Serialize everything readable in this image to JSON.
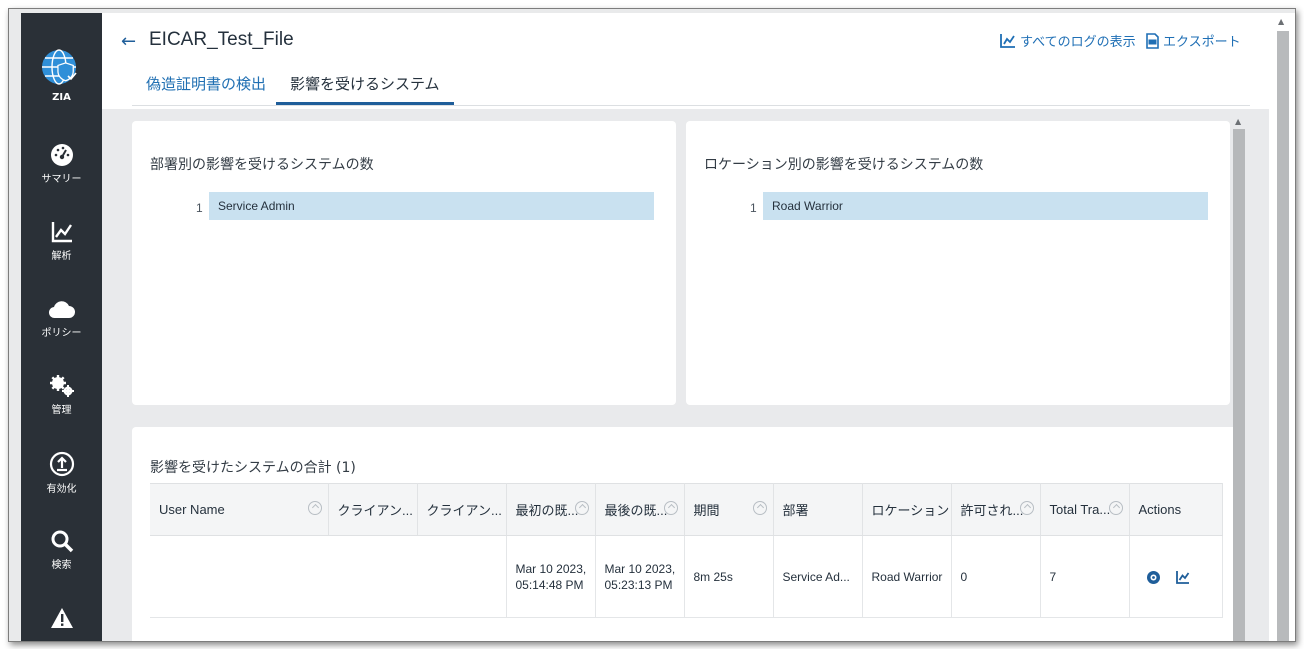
{
  "app": {
    "logo_label": "ZIA"
  },
  "nav": {
    "items": [
      {
        "label": "サマリー",
        "icon": "dashboard-icon"
      },
      {
        "label": "解析",
        "icon": "line-chart-icon"
      },
      {
        "label": "ポリシー",
        "icon": "cloud-icon"
      },
      {
        "label": "管理",
        "icon": "gears-icon"
      },
      {
        "label": "有効化",
        "icon": "upload-icon"
      },
      {
        "label": "検索",
        "icon": "search-icon"
      },
      {
        "label": "",
        "icon": "alert-icon"
      }
    ]
  },
  "header": {
    "title": "EICAR_Test_File",
    "links": {
      "view_all_logs": "すべてのログの表示",
      "export": "エクスポート"
    },
    "tabs": [
      {
        "label": "偽造証明書の検出",
        "active": false
      },
      {
        "label": "影響を受けるシステム",
        "active": true
      }
    ]
  },
  "cards": {
    "by_department": {
      "title": "部署別の影響を受けるシステムの数",
      "bars": [
        {
          "rank": "1",
          "label": "Service Admin"
        }
      ]
    },
    "by_location": {
      "title": "ロケーション別の影響を受けるシステムの数",
      "bars": [
        {
          "rank": "1",
          "label": "Road Warrior"
        }
      ]
    }
  },
  "systems_table": {
    "title": "影響を受けたシステムの合計 (1)",
    "columns": [
      "User Name",
      "クライアン...",
      "クライアン...",
      "最初の既...",
      "最後の既...",
      "期間",
      "部署",
      "ロケーション",
      "許可され...",
      "Total Tra...",
      "Actions"
    ],
    "rows": [
      {
        "user_name": "",
        "client_1": "",
        "client_2": "",
        "first_seen_date": "Mar 10 2023,",
        "first_seen_time": "05:14:48 PM",
        "last_seen_date": "Mar 10 2023,",
        "last_seen_time": "05:23:13 PM",
        "duration": "8m 25s",
        "department": "Service Ad...",
        "location": "Road Warrior",
        "allowed": "0",
        "total_transactions": "7"
      }
    ]
  },
  "colors": {
    "accent": "#1f5e9a",
    "nav_bg": "#2a3037",
    "bar_fill": "#c9e1f0",
    "logo_blue": "#2f8fd8"
  }
}
